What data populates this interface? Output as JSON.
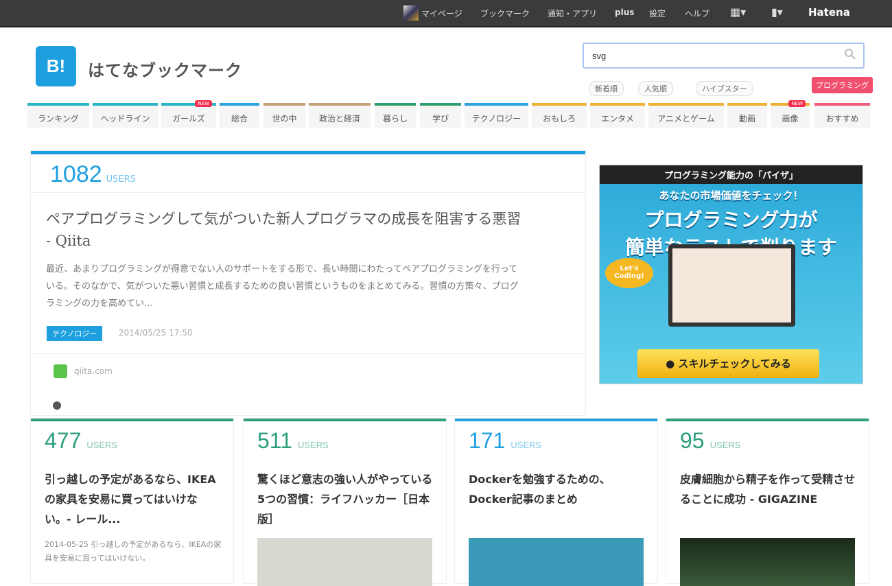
{
  "topbar": {
    "items": [
      "マイページ",
      "ブックマーク",
      "通知・アプリ",
      "plus",
      "設定",
      "ヘルプ"
    ],
    "brand": "Hatena"
  },
  "header": {
    "logo": "B!",
    "title": "はてなブックマーク"
  },
  "search": {
    "value": "svg",
    "options": [
      "新着順",
      "人気順",
      "ハイブスター"
    ],
    "promo": "プログラミング"
  },
  "nav": [
    {
      "label": "ランキング"
    },
    {
      "label": "ヘッドライン"
    },
    {
      "label": "ガールズ",
      "badge": "NEW"
    },
    {
      "label": "総合"
    },
    {
      "label": "世の中"
    },
    {
      "label": "政治と経済"
    },
    {
      "label": "暮らし"
    },
    {
      "label": "学び"
    },
    {
      "label": "テクノロジー"
    },
    {
      "label": "おもしろ"
    },
    {
      "label": "エンタメ"
    },
    {
      "label": "アニメとゲーム"
    },
    {
      "label": "動画"
    },
    {
      "label": "画像",
      "badge": "NEW"
    },
    {
      "label": "おすすめ"
    }
  ],
  "main": {
    "count": "1082",
    "users": "USERS",
    "title": "ペアプログラミングして気がついた新人プログラマの成長を阻害する悪習 - Qiita",
    "excerpt": "最近、あまりプログラミングが得意でない人のサポートをする形で、長い時間にわたってペアプログラミングを行っている。そのなかで、気がついた悪い習慣と成長するための良い習慣というものをまとめてみる。習慣の方策々、プログラミングの力を高めてい...",
    "tag": "テクノロジー",
    "date": "2014/05/25 17:50",
    "domain": "qiita.com"
  },
  "ad": {
    "top": "プログラミング能力の「パイザ」",
    "sub": "あなたの市場価値をチェック！",
    "h1": "プログラミング力が",
    "h2": "簡単なテストで判ります",
    "bubble": "Let's Coding!",
    "button": "スキルチェックしてみる"
  },
  "cards": [
    {
      "count": "477",
      "users": "USERS",
      "title": "引っ越しの予定があるなら、IKEAの家具を安易に買ってはいけない。- レール...",
      "snippet": "2014-05-25 引っ越しの予定があるなら、IKEAの家具を安易に買ってはいけない。"
    },
    {
      "count": "511",
      "users": "USERS",
      "title": "驚くほど意志の強い人がやっている5つの習慣：ライフハッカー［日本版］"
    },
    {
      "count": "171",
      "users": "USERS",
      "title": "Dockerを勉強するための、Docker記事のまとめ"
    },
    {
      "count": "95",
      "users": "USERS",
      "title": "皮膚細胞から精子を作って受精させることに成功 - GIGAZINE"
    }
  ],
  "colors": {
    "accent": "#1ea0e0",
    "green": "#2d9e7e"
  }
}
